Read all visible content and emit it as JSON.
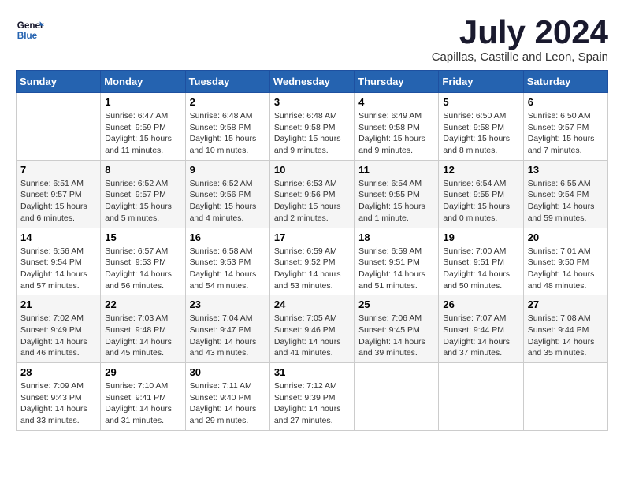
{
  "header": {
    "logo_line1": "General",
    "logo_line2": "Blue",
    "month_year": "July 2024",
    "location": "Capillas, Castille and Leon, Spain"
  },
  "days_of_week": [
    "Sunday",
    "Monday",
    "Tuesday",
    "Wednesday",
    "Thursday",
    "Friday",
    "Saturday"
  ],
  "weeks": [
    [
      {
        "day": "",
        "info": ""
      },
      {
        "day": "1",
        "info": "Sunrise: 6:47 AM\nSunset: 9:59 PM\nDaylight: 15 hours\nand 11 minutes."
      },
      {
        "day": "2",
        "info": "Sunrise: 6:48 AM\nSunset: 9:58 PM\nDaylight: 15 hours\nand 10 minutes."
      },
      {
        "day": "3",
        "info": "Sunrise: 6:48 AM\nSunset: 9:58 PM\nDaylight: 15 hours\nand 9 minutes."
      },
      {
        "day": "4",
        "info": "Sunrise: 6:49 AM\nSunset: 9:58 PM\nDaylight: 15 hours\nand 9 minutes."
      },
      {
        "day": "5",
        "info": "Sunrise: 6:50 AM\nSunset: 9:58 PM\nDaylight: 15 hours\nand 8 minutes."
      },
      {
        "day": "6",
        "info": "Sunrise: 6:50 AM\nSunset: 9:57 PM\nDaylight: 15 hours\nand 7 minutes."
      }
    ],
    [
      {
        "day": "7",
        "info": "Sunrise: 6:51 AM\nSunset: 9:57 PM\nDaylight: 15 hours\nand 6 minutes."
      },
      {
        "day": "8",
        "info": "Sunrise: 6:52 AM\nSunset: 9:57 PM\nDaylight: 15 hours\nand 5 minutes."
      },
      {
        "day": "9",
        "info": "Sunrise: 6:52 AM\nSunset: 9:56 PM\nDaylight: 15 hours\nand 4 minutes."
      },
      {
        "day": "10",
        "info": "Sunrise: 6:53 AM\nSunset: 9:56 PM\nDaylight: 15 hours\nand 2 minutes."
      },
      {
        "day": "11",
        "info": "Sunrise: 6:54 AM\nSunset: 9:55 PM\nDaylight: 15 hours\nand 1 minute."
      },
      {
        "day": "12",
        "info": "Sunrise: 6:54 AM\nSunset: 9:55 PM\nDaylight: 15 hours\nand 0 minutes."
      },
      {
        "day": "13",
        "info": "Sunrise: 6:55 AM\nSunset: 9:54 PM\nDaylight: 14 hours\nand 59 minutes."
      }
    ],
    [
      {
        "day": "14",
        "info": "Sunrise: 6:56 AM\nSunset: 9:54 PM\nDaylight: 14 hours\nand 57 minutes."
      },
      {
        "day": "15",
        "info": "Sunrise: 6:57 AM\nSunset: 9:53 PM\nDaylight: 14 hours\nand 56 minutes."
      },
      {
        "day": "16",
        "info": "Sunrise: 6:58 AM\nSunset: 9:53 PM\nDaylight: 14 hours\nand 54 minutes."
      },
      {
        "day": "17",
        "info": "Sunrise: 6:59 AM\nSunset: 9:52 PM\nDaylight: 14 hours\nand 53 minutes."
      },
      {
        "day": "18",
        "info": "Sunrise: 6:59 AM\nSunset: 9:51 PM\nDaylight: 14 hours\nand 51 minutes."
      },
      {
        "day": "19",
        "info": "Sunrise: 7:00 AM\nSunset: 9:51 PM\nDaylight: 14 hours\nand 50 minutes."
      },
      {
        "day": "20",
        "info": "Sunrise: 7:01 AM\nSunset: 9:50 PM\nDaylight: 14 hours\nand 48 minutes."
      }
    ],
    [
      {
        "day": "21",
        "info": "Sunrise: 7:02 AM\nSunset: 9:49 PM\nDaylight: 14 hours\nand 46 minutes."
      },
      {
        "day": "22",
        "info": "Sunrise: 7:03 AM\nSunset: 9:48 PM\nDaylight: 14 hours\nand 45 minutes."
      },
      {
        "day": "23",
        "info": "Sunrise: 7:04 AM\nSunset: 9:47 PM\nDaylight: 14 hours\nand 43 minutes."
      },
      {
        "day": "24",
        "info": "Sunrise: 7:05 AM\nSunset: 9:46 PM\nDaylight: 14 hours\nand 41 minutes."
      },
      {
        "day": "25",
        "info": "Sunrise: 7:06 AM\nSunset: 9:45 PM\nDaylight: 14 hours\nand 39 minutes."
      },
      {
        "day": "26",
        "info": "Sunrise: 7:07 AM\nSunset: 9:44 PM\nDaylight: 14 hours\nand 37 minutes."
      },
      {
        "day": "27",
        "info": "Sunrise: 7:08 AM\nSunset: 9:44 PM\nDaylight: 14 hours\nand 35 minutes."
      }
    ],
    [
      {
        "day": "28",
        "info": "Sunrise: 7:09 AM\nSunset: 9:43 PM\nDaylight: 14 hours\nand 33 minutes."
      },
      {
        "day": "29",
        "info": "Sunrise: 7:10 AM\nSunset: 9:41 PM\nDaylight: 14 hours\nand 31 minutes."
      },
      {
        "day": "30",
        "info": "Sunrise: 7:11 AM\nSunset: 9:40 PM\nDaylight: 14 hours\nand 29 minutes."
      },
      {
        "day": "31",
        "info": "Sunrise: 7:12 AM\nSunset: 9:39 PM\nDaylight: 14 hours\nand 27 minutes."
      },
      {
        "day": "",
        "info": ""
      },
      {
        "day": "",
        "info": ""
      },
      {
        "day": "",
        "info": ""
      }
    ]
  ]
}
